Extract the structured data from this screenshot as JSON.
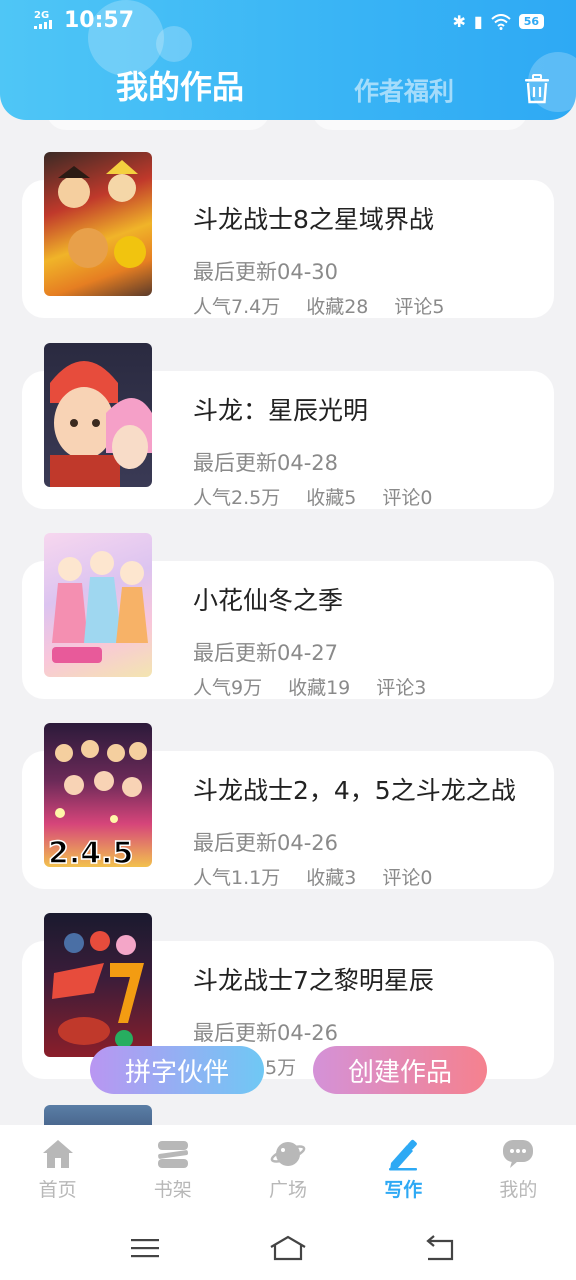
{
  "status_bar": {
    "network": "2G",
    "time": "10:57",
    "battery": "56"
  },
  "header": {
    "tab_active": "我的作品",
    "tab_inactive": "作者福利"
  },
  "works": [
    {
      "title": "斗龙战士8之星域界战",
      "update": "最后更新04-30",
      "popularity": "人气7.4万",
      "favorites": "收藏28",
      "comments": "评论5"
    },
    {
      "title": "斗龙：星辰光明",
      "update": "最后更新04-28",
      "popularity": "人气2.5万",
      "favorites": "收藏5",
      "comments": "评论0"
    },
    {
      "title": "小花仙冬之季",
      "update": "最后更新04-27",
      "popularity": "人气9万",
      "favorites": "收藏19",
      "comments": "评论3"
    },
    {
      "title": "斗龙战士2，4，5之斗龙之战",
      "update": "最后更新04-26",
      "popularity": "人气1.1万",
      "favorites": "收藏3",
      "comments": "评论0"
    },
    {
      "title": "斗龙战士7之黎明星辰",
      "update": "最后更新04-26",
      "popularity": "5万",
      "favorites": "",
      "comments": ""
    }
  ],
  "floating_buttons": {
    "partner": "拼字伙伴",
    "create": "创建作品"
  },
  "bottom_nav": [
    {
      "label": "首页",
      "icon": "home-icon"
    },
    {
      "label": "书架",
      "icon": "bookshelf-icon"
    },
    {
      "label": "广场",
      "icon": "planet-icon"
    },
    {
      "label": "写作",
      "icon": "pen-icon"
    },
    {
      "label": "我的",
      "icon": "chat-icon"
    }
  ],
  "colors": {
    "accent": "#2ea9f4",
    "header_start": "#4fc6f6",
    "create_btn": "#f5818e",
    "partner_btn": "#6fc8f4"
  }
}
